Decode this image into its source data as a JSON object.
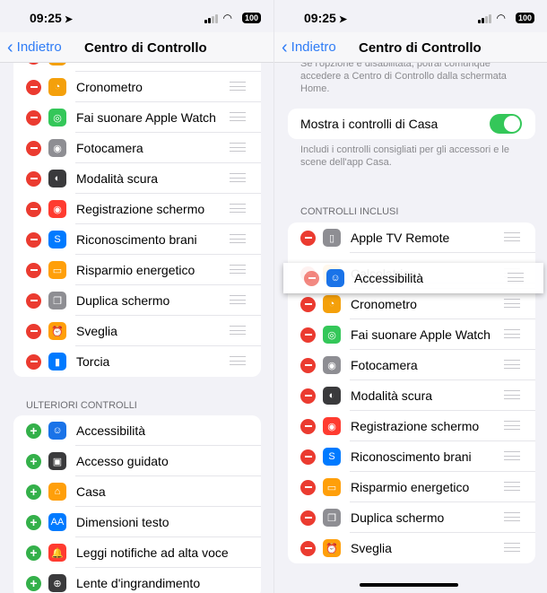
{
  "status": {
    "time": "09:25",
    "battery": "100"
  },
  "nav": {
    "back": "Indietro",
    "title": "Centro di Controllo"
  },
  "left": {
    "included": [
      {
        "label": "",
        "color": "#f4a00b",
        "icon": "calculator-icon",
        "glyph": ""
      },
      {
        "label": "Cronometro",
        "color": "#f4a00b",
        "icon": "stopwatch-icon",
        "glyph": "◔"
      },
      {
        "label": "Fai suonare Apple Watch",
        "color": "#34c759",
        "icon": "watch-icon",
        "glyph": "◎"
      },
      {
        "label": "Fotocamera",
        "color": "#8e8e93",
        "icon": "camera-icon",
        "glyph": "◉"
      },
      {
        "label": "Modalità scura",
        "color": "#3a3a3c",
        "icon": "dark-mode-icon",
        "glyph": "◐"
      },
      {
        "label": "Registrazione schermo",
        "color": "#ff3b30",
        "icon": "screen-record-icon",
        "glyph": "◉"
      },
      {
        "label": "Riconoscimento brani",
        "color": "#007aff",
        "icon": "shazam-icon",
        "glyph": "S"
      },
      {
        "label": "Risparmio energetico",
        "color": "#ff9f0a",
        "icon": "battery-icon",
        "glyph": "▭"
      },
      {
        "label": "Duplica schermo",
        "color": "#8e8e93",
        "icon": "screen-mirroring-icon",
        "glyph": "❐"
      },
      {
        "label": "Sveglia",
        "color": "#ff9f0a",
        "icon": "alarm-icon",
        "glyph": "⏰"
      },
      {
        "label": "Torcia",
        "color": "#007aff",
        "icon": "flashlight-icon",
        "glyph": "▮"
      }
    ],
    "more_header": "ULTERIORI CONTROLLI",
    "more": [
      {
        "label": "Accessibilità",
        "color": "#1a73e8",
        "icon": "accessibility-icon",
        "glyph": "☺"
      },
      {
        "label": "Accesso guidato",
        "color": "#3a3a3c",
        "icon": "guided-access-icon",
        "glyph": "▣"
      },
      {
        "label": "Casa",
        "color": "#ff9f0a",
        "icon": "home-icon",
        "glyph": "⌂"
      },
      {
        "label": "Dimensioni testo",
        "color": "#007aff",
        "icon": "text-size-icon",
        "glyph": "AA"
      },
      {
        "label": "Leggi notifiche ad alta voce",
        "color": "#ff3b30",
        "icon": "announce-notifications-icon",
        "glyph": "🔔"
      },
      {
        "label": "Lente d'ingrandimento",
        "color": "#3a3a3c",
        "icon": "magnifier-icon",
        "glyph": "⊕"
      }
    ]
  },
  "right": {
    "top_note": "Se l'opzione è disabilitata, potrai comunque accedere a Centro di Controllo dalla schermata Home.",
    "home_toggle": {
      "label": "Mostra i controlli di Casa",
      "on": true
    },
    "home_note": "Includi i controlli consigliati per gli accessori e le scene dell'app Casa.",
    "included_header": "CONTROLLI INCLUSI",
    "dragging": {
      "label": "Accessibilità",
      "color": "#1a73e8",
      "icon": "accessibility-icon",
      "glyph": "☺"
    },
    "included": [
      {
        "label": "Apple TV Remote",
        "color": "#8e8e93",
        "icon": "remote-icon",
        "glyph": "▯"
      },
      {
        "label": "",
        "color": "#fff",
        "icon": "placeholder",
        "glyph": ""
      },
      {
        "label": "Calcolatrice",
        "color": "#f4a00b",
        "icon": "calculator-icon",
        "glyph": "▦"
      },
      {
        "label": "Cronometro",
        "color": "#f4a00b",
        "icon": "stopwatch-icon",
        "glyph": "◔"
      },
      {
        "label": "Fai suonare Apple Watch",
        "color": "#34c759",
        "icon": "watch-icon",
        "glyph": "◎"
      },
      {
        "label": "Fotocamera",
        "color": "#8e8e93",
        "icon": "camera-icon",
        "glyph": "◉"
      },
      {
        "label": "Modalità scura",
        "color": "#3a3a3c",
        "icon": "dark-mode-icon",
        "glyph": "◐"
      },
      {
        "label": "Registrazione schermo",
        "color": "#ff3b30",
        "icon": "screen-record-icon",
        "glyph": "◉"
      },
      {
        "label": "Riconoscimento brani",
        "color": "#007aff",
        "icon": "shazam-icon",
        "glyph": "S"
      },
      {
        "label": "Risparmio energetico",
        "color": "#ff9f0a",
        "icon": "battery-icon",
        "glyph": "▭"
      },
      {
        "label": "Duplica schermo",
        "color": "#8e8e93",
        "icon": "screen-mirroring-icon",
        "glyph": "❐"
      },
      {
        "label": "Sveglia",
        "color": "#ff9f0a",
        "icon": "alarm-icon",
        "glyph": "⏰"
      }
    ]
  }
}
